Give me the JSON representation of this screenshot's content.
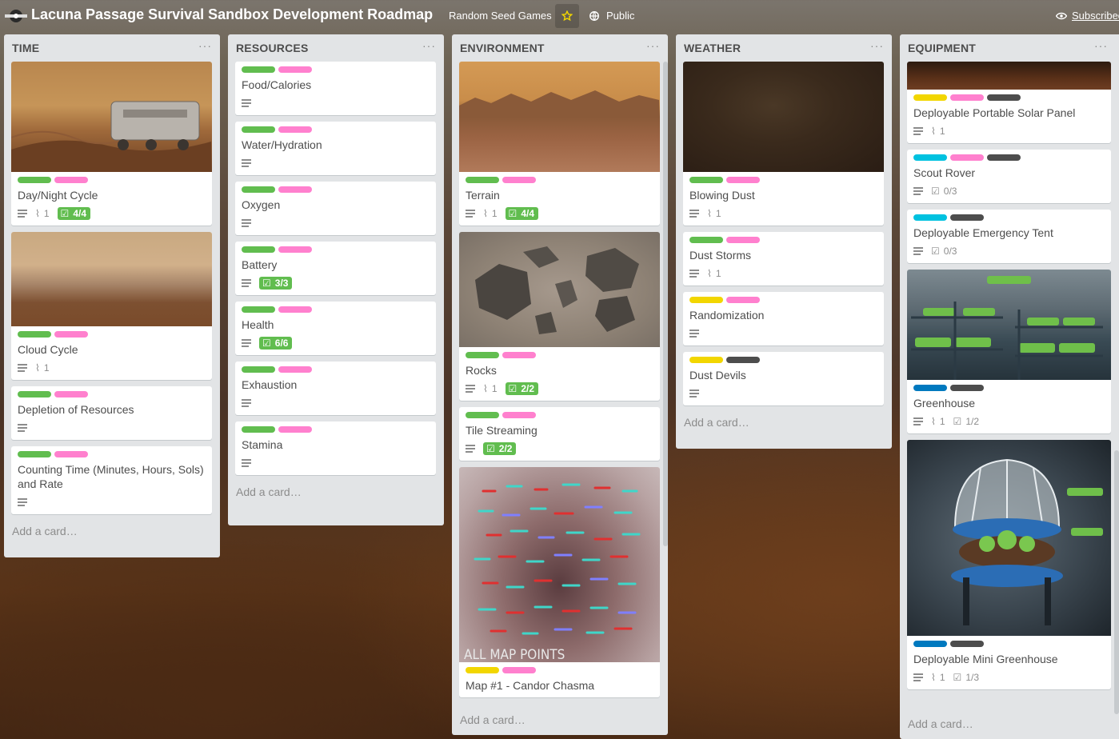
{
  "header": {
    "title": "Lacuna Passage Survival Sandbox Development Roadmap",
    "team": "Random Seed Games",
    "visibility": "Public",
    "subscribed": "Subscribed"
  },
  "colors": {
    "green": "#61bd4f",
    "pink": "#ff80ce",
    "yellow": "#f2d600",
    "black": "#4d4d4d",
    "sky": "#00c2e0",
    "blue": "#0079bf"
  },
  "add_card": "Add a card…",
  "lists": {
    "time": {
      "title": "TIME",
      "cards": [
        {
          "title": "Day/Night Cycle",
          "attachments": "1",
          "checklist": "4/4"
        },
        {
          "title": "Cloud Cycle",
          "attachments": "1"
        },
        {
          "title": "Depletion of Resources"
        },
        {
          "title": "Counting Time (Minutes, Hours, Sols) and Rate"
        }
      ]
    },
    "resources": {
      "title": "RESOURCES",
      "cards": [
        {
          "title": "Food/Calories"
        },
        {
          "title": "Water/Hydration"
        },
        {
          "title": "Oxygen"
        },
        {
          "title": "Battery",
          "checklist": "3/3"
        },
        {
          "title": "Health",
          "checklist": "6/6"
        },
        {
          "title": "Exhaustion"
        },
        {
          "title": "Stamina"
        }
      ]
    },
    "environment": {
      "title": "ENVIRONMENT",
      "cards": [
        {
          "title": "Terrain",
          "attachments": "1",
          "checklist": "4/4"
        },
        {
          "title": "Rocks",
          "attachments": "1",
          "checklist": "2/2"
        },
        {
          "title": "Tile Streaming",
          "checklist": "2/2"
        },
        {
          "title": "Map #1 - Candor Chasma",
          "image_text": "ALL MAP POINTS"
        }
      ]
    },
    "weather": {
      "title": "WEATHER",
      "cards": [
        {
          "title": "Blowing Dust",
          "attachments": "1"
        },
        {
          "title": "Dust Storms",
          "attachments": "1"
        },
        {
          "title": "Randomization"
        },
        {
          "title": "Dust Devils"
        }
      ]
    },
    "equipment": {
      "title": "EQUIPMENT",
      "cards": [
        {
          "title": "Deployable Portable Solar Panel",
          "attachments": "1"
        },
        {
          "title": "Scout Rover",
          "checklist": "0/3"
        },
        {
          "title": "Deployable Emergency Tent",
          "checklist": "0/3"
        },
        {
          "title": "Greenhouse",
          "attachments": "1",
          "checklist": "1/2"
        },
        {
          "title": "Deployable Mini Greenhouse",
          "attachments": "1",
          "checklist": "1/3"
        }
      ]
    }
  }
}
